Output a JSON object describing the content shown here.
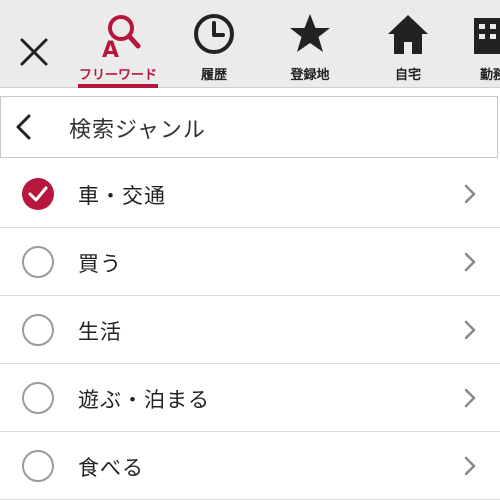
{
  "colors": {
    "accent": "#b8173d",
    "tab_bg": "#ebebeb",
    "chevron": "#8a8a8a",
    "radio_border": "#9a9a9a"
  },
  "tabs": [
    {
      "label": "フリーワード",
      "icon": "search-freeword-icon",
      "active": true
    },
    {
      "label": "履歴",
      "icon": "clock-icon",
      "active": false
    },
    {
      "label": "登録地",
      "icon": "star-icon",
      "active": false
    },
    {
      "label": "自宅",
      "icon": "home-icon",
      "active": false
    },
    {
      "label": "勤務",
      "icon": "building-icon",
      "active": false
    }
  ],
  "header": {
    "title": "検索ジャンル"
  },
  "genres": [
    {
      "label": "車・交通",
      "checked": true
    },
    {
      "label": "買う",
      "checked": false
    },
    {
      "label": "生活",
      "checked": false
    },
    {
      "label": "遊ぶ・泊まる",
      "checked": false
    },
    {
      "label": "食べる",
      "checked": false
    }
  ]
}
